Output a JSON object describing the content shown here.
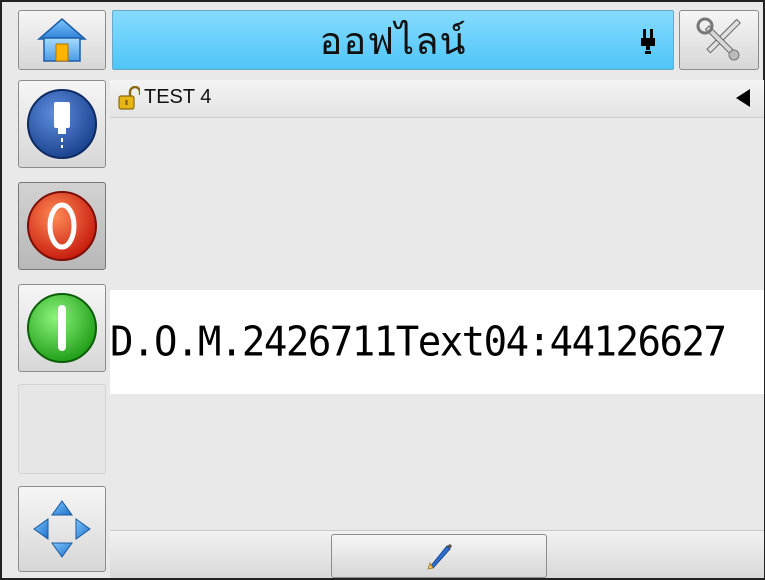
{
  "header": {
    "status_text": "ออฟไลน์",
    "home_icon": "home-icon",
    "tools_icon": "tools-icon",
    "plug_icon": "plug-icon"
  },
  "sidebar": {
    "items": [
      {
        "icon": "ink-bottle-icon",
        "label": ""
      },
      {
        "icon": "stop-icon",
        "label": ""
      },
      {
        "icon": "start-icon",
        "label": ""
      },
      {
        "icon": "blank",
        "label": ""
      },
      {
        "icon": "navigate-arrows-icon",
        "label": ""
      }
    ]
  },
  "message": {
    "name": "TEST 4",
    "print_text": "D.O.M.2426711Text04:44126627"
  },
  "colors": {
    "status_bar": "#5fcdf9",
    "stop": "#e8421e",
    "start": "#34c324",
    "ink": "#2a5ab0",
    "arrows": "#3a8fd9"
  }
}
